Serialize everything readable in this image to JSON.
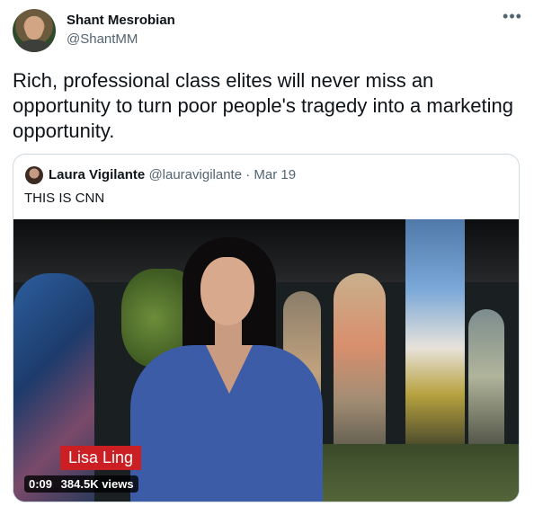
{
  "tweet": {
    "author_name": "Shant Mesrobian",
    "author_handle": "@ShantMM",
    "more_icon": "more-horizontal-icon",
    "text": "Rich, professional class elites will never miss an opportunity to turn poor people's tragedy into a marketing opportunity."
  },
  "quoted_tweet": {
    "author_name": "Laura Vigilante",
    "author_handle": "@lauravigilante",
    "separator": "·",
    "date": "Mar 19",
    "text": "THIS IS CNN",
    "video": {
      "lower_third_name": "Lisa Ling",
      "duration": "0:09",
      "views": "384.5K views"
    }
  },
  "colors": {
    "text": "#0f1419",
    "secondary_text": "#536471",
    "border": "#cfd9de",
    "lower_third": "#cc1f24"
  }
}
